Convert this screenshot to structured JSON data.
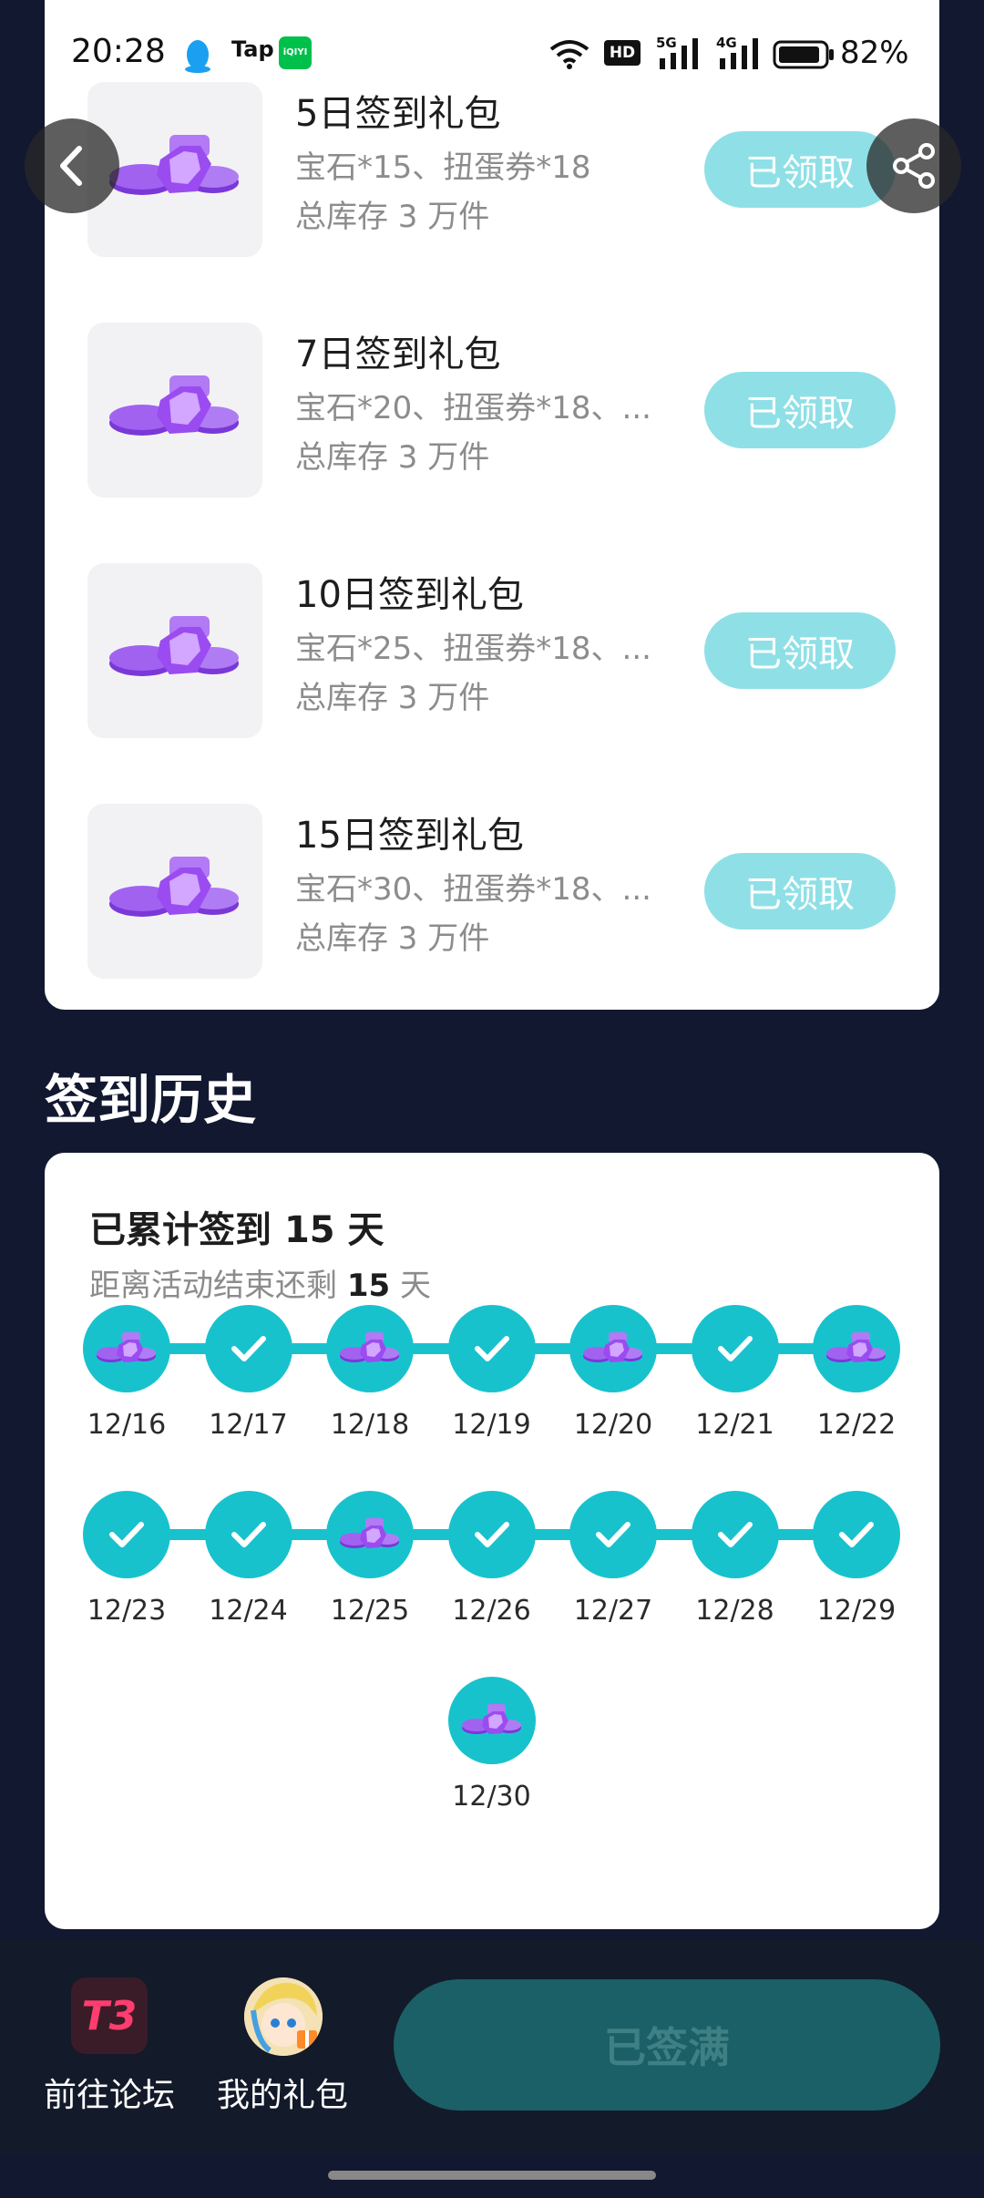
{
  "status_bar": {
    "time": "20:28",
    "battery": "82%",
    "app_icons": [
      "qq-icon",
      "tap-icon",
      "iqiyi-icon"
    ],
    "indicator_labels": {
      "hd": "HD",
      "sig1": "5G",
      "sig2": "4G",
      "iqiyi": "iQIYI"
    },
    "system_icons": [
      "wifi-icon",
      "hd-icon",
      "signal-5g-icon",
      "signal-4g-icon",
      "battery-icon"
    ]
  },
  "nav": {
    "back_icon": "chevron-left-icon",
    "share_icon": "share-icon"
  },
  "gift_packs": [
    {
      "title": "5日签到礼包",
      "desc": "宝石*15、扭蛋券*18",
      "stock": "总库存 3 万件",
      "button": "已领取"
    },
    {
      "title": "7日签到礼包",
      "desc": "宝石*20、扭蛋券*18、...",
      "stock": "总库存 3 万件",
      "button": "已领取"
    },
    {
      "title": "10日签到礼包",
      "desc": "宝石*25、扭蛋券*18、...",
      "stock": "总库存 3 万件",
      "button": "已领取"
    },
    {
      "title": "15日签到礼包",
      "desc": "宝石*30、扭蛋券*18、...",
      "stock": "总库存 3 万件",
      "button": "已领取"
    }
  ],
  "history": {
    "section_title": "签到历史",
    "title_prefix": "已累计签到 ",
    "title_days": "15",
    "title_suffix": " 天",
    "sub_prefix": "距离活动结束还剩 ",
    "sub_days": "15",
    "sub_suffix": " 天",
    "days": [
      {
        "date": "12/16",
        "icon": "gift"
      },
      {
        "date": "12/17",
        "icon": "check"
      },
      {
        "date": "12/18",
        "icon": "gift"
      },
      {
        "date": "12/19",
        "icon": "check"
      },
      {
        "date": "12/20",
        "icon": "gift"
      },
      {
        "date": "12/21",
        "icon": "check"
      },
      {
        "date": "12/22",
        "icon": "gift"
      },
      {
        "date": "12/23",
        "icon": "check"
      },
      {
        "date": "12/24",
        "icon": "check"
      },
      {
        "date": "12/25",
        "icon": "gift"
      },
      {
        "date": "12/26",
        "icon": "check"
      },
      {
        "date": "12/27",
        "icon": "check"
      },
      {
        "date": "12/28",
        "icon": "check"
      },
      {
        "date": "12/29",
        "icon": "check"
      },
      {
        "date": "12/30",
        "icon": "gift"
      }
    ]
  },
  "bottom_bar": {
    "forum_label": "前往论坛",
    "forum_icon_text": "T3",
    "my_gifts_label": "我的礼包",
    "main_button": "已签满"
  },
  "colors": {
    "background": "#121830",
    "accent": "#18c2cd",
    "claimed_button": "#8fe0e6",
    "main_button": "#1b6066"
  }
}
